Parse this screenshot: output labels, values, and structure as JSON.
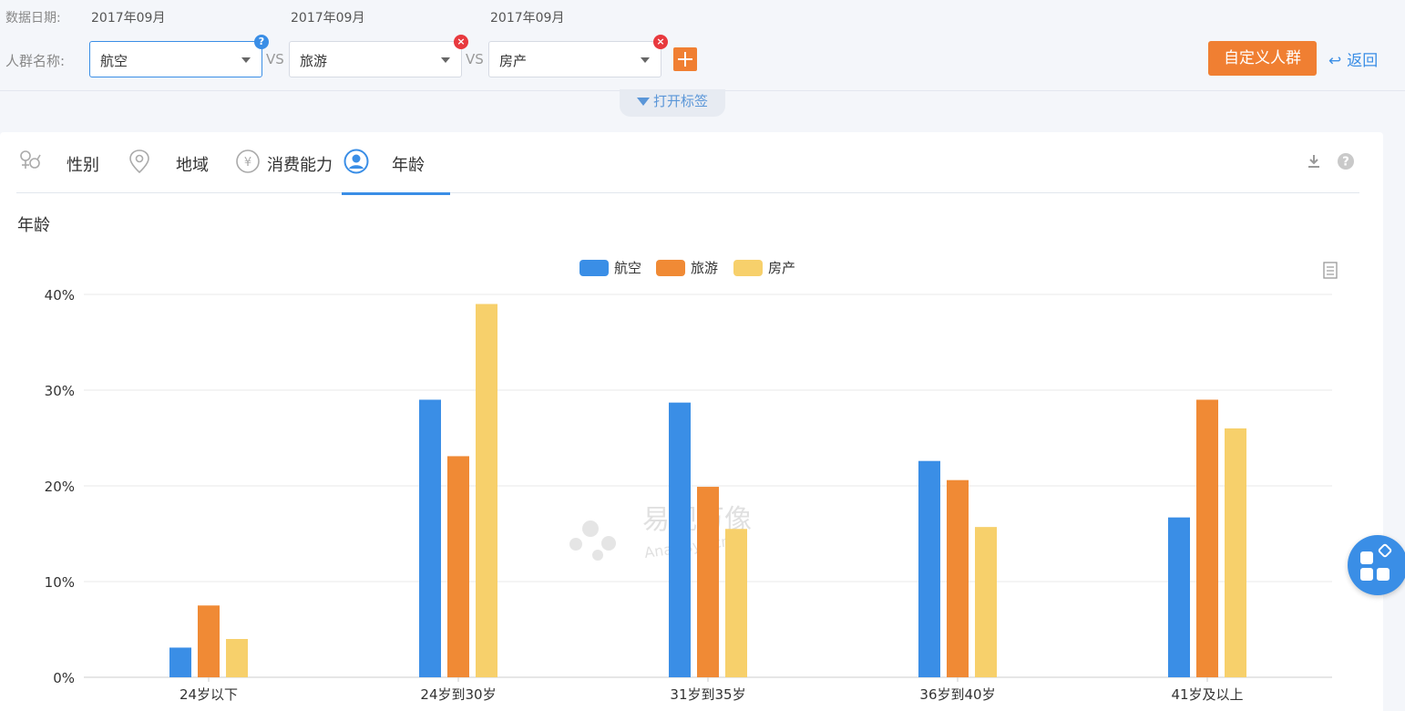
{
  "filters": {
    "date_label": "数据日期:",
    "dates": [
      "2017年09月",
      "2017年09月",
      "2017年09月"
    ],
    "crowd_label": "人群名称:",
    "crowds": [
      "航空",
      "旅游",
      "房产"
    ],
    "vs": "VS",
    "help_badge": "?",
    "close_badge": "×"
  },
  "actions": {
    "custom_crowd": "自定义人群",
    "back": "返回",
    "open_tags": "打开标签"
  },
  "tabs": [
    {
      "label": "性别",
      "icon": "gender-icon"
    },
    {
      "label": "地域",
      "icon": "location-pin-icon"
    },
    {
      "label": "消费能力",
      "icon": "yen-icon"
    },
    {
      "label": "年龄",
      "icon": "user-icon",
      "active": true
    }
  ],
  "section_title": "年龄",
  "watermark": {
    "cn": "易观万像",
    "en": "Analysys.cn"
  },
  "colors": {
    "series": [
      "#3a8ee6",
      "#f08a35",
      "#f7d06b"
    ],
    "accent": "#3a8ee6",
    "orange": "#f07f32"
  },
  "chart_data": {
    "type": "bar",
    "categories": [
      "24岁以下",
      "24岁到30岁",
      "31岁到35岁",
      "36岁到40岁",
      "41岁及以上"
    ],
    "series": [
      {
        "name": "航空",
        "values": [
          3.1,
          29.0,
          28.7,
          22.6,
          16.7
        ]
      },
      {
        "name": "旅游",
        "values": [
          7.5,
          23.1,
          19.9,
          20.6,
          29.0
        ]
      },
      {
        "name": "房产",
        "values": [
          4.0,
          39.0,
          15.5,
          15.7,
          26.0
        ]
      }
    ],
    "yticks": [
      "0%",
      "10%",
      "20%",
      "30%",
      "40%"
    ],
    "ylim": [
      0,
      40
    ],
    "grid": true,
    "legend": "top-center"
  }
}
